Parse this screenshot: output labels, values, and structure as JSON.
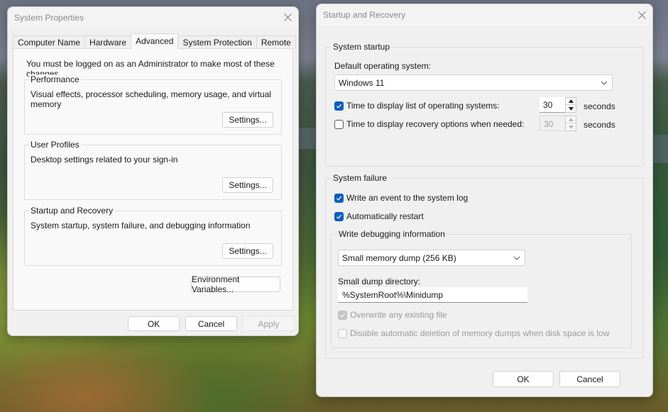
{
  "system_properties": {
    "title": "System Properties",
    "tabs": [
      {
        "label": "Computer Name",
        "active": false
      },
      {
        "label": "Hardware",
        "active": false
      },
      {
        "label": "Advanced",
        "active": true
      },
      {
        "label": "System Protection",
        "active": false
      },
      {
        "label": "Remote",
        "active": false
      }
    ],
    "admin_note": "You must be logged on as an Administrator to make most of these changes.",
    "groups": [
      {
        "title": "Performance",
        "description": "Visual effects, processor scheduling, memory usage, and virtual memory",
        "button": "Settings..."
      },
      {
        "title": "User Profiles",
        "description": "Desktop settings related to your sign-in",
        "button": "Settings..."
      },
      {
        "title": "Startup and Recovery",
        "description": "System startup, system failure, and debugging information",
        "button": "Settings..."
      }
    ],
    "env_vars_button": "Environment Variables...",
    "ok_button": "OK",
    "cancel_button": "Cancel",
    "apply_button": "Apply"
  },
  "startup_recovery": {
    "title": "Startup and Recovery",
    "system_startup": {
      "legend": "System startup",
      "default_os_label": "Default operating system:",
      "default_os_value": "Windows 11",
      "display_os_list": {
        "label": "Time to display list of operating systems:",
        "checked": true,
        "value": "30",
        "unit": "seconds"
      },
      "display_recovery": {
        "label": "Time to display recovery options when needed:",
        "checked": false,
        "value": "30",
        "unit": "seconds"
      }
    },
    "system_failure": {
      "legend": "System failure",
      "write_event": {
        "label": "Write an event to the system log",
        "checked": true
      },
      "auto_restart": {
        "label": "Automatically restart",
        "checked": true
      },
      "debug": {
        "legend": "Write debugging information",
        "dump_type": "Small memory dump (256 KB)",
        "dump_dir_label": "Small dump directory:",
        "dump_dir_value": "%SystemRoot%\\Minidump",
        "overwrite": {
          "label": "Overwrite any existing file",
          "checked": true,
          "disabled": true
        },
        "disable_auto_delete": {
          "label": "Disable automatic deletion of memory dumps when disk space is low",
          "checked": false,
          "disabled": true
        }
      }
    },
    "ok_button": "OK",
    "cancel_button": "Cancel"
  },
  "colors": {
    "accent": "#0a5fbd",
    "dialog_bg": "#f0f0f0",
    "disabled_text": "#9a9a9a"
  }
}
